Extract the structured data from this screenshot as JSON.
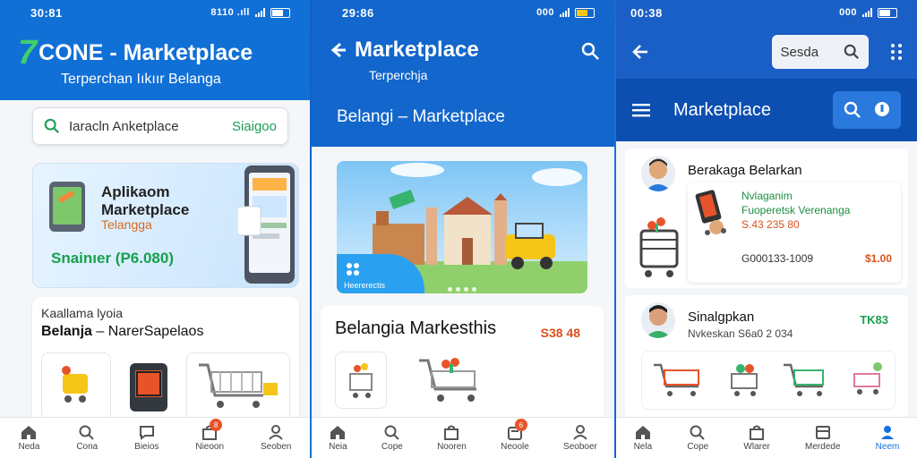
{
  "colors": {
    "brand_blue": "#1266cc",
    "accent_green": "#1f9d55",
    "accent_orange": "#d9521e",
    "active_nav": "#1570e0"
  },
  "screen1": {
    "status": {
      "time": "30:81",
      "icons": "8110 .ıll"
    },
    "logo_char": "7",
    "title": "CONE - Marketplace",
    "subtitle": "Terperchan Iıkıır Belanga",
    "search": {
      "placeholder": "Iaracln Anketplace",
      "button": "Siaigoo"
    },
    "banner": {
      "title_line1": "Aplikaom",
      "title_line2": "Marketplace",
      "tag": "Telangga",
      "price": "Snainıer (P6.080)"
    },
    "section": {
      "small": "Kaallama lyoia",
      "label_bold": "Belanja",
      "label_rest": " – NarerSapelaos"
    },
    "nav": [
      {
        "icon": "home-icon",
        "label": "Neda",
        "badge": ""
      },
      {
        "icon": "search-icon",
        "label": "Cona",
        "badge": ""
      },
      {
        "icon": "chat-icon",
        "label": "Bieios",
        "badge": ""
      },
      {
        "icon": "bag-icon",
        "label": "Nieoon",
        "badge": "8"
      },
      {
        "icon": "user-icon",
        "label": "Seoben",
        "badge": ""
      }
    ]
  },
  "screen2": {
    "status": {
      "time": "29:86",
      "icons": "000"
    },
    "title": "Marketplace",
    "subtitle": "Terperchja",
    "section_title": "Belangi – Marketplace",
    "hero": {
      "chip_label": "Heererectis"
    },
    "card": {
      "title": "Belangia Markesthis",
      "price": "S38 48"
    },
    "nav": [
      {
        "icon": "home-icon",
        "label": "Neia",
        "badge": ""
      },
      {
        "icon": "search-icon",
        "label": "Cope",
        "badge": ""
      },
      {
        "icon": "bag-icon",
        "label": "Nooren",
        "badge": ""
      },
      {
        "icon": "cart-icon",
        "label": "Neoole",
        "badge": "6"
      },
      {
        "icon": "user-icon",
        "label": "Seoboer",
        "badge": ""
      }
    ]
  },
  "screen3": {
    "status": {
      "time": "00:38",
      "icons": "000"
    },
    "search_label": "Sesda",
    "title": "Marketplace",
    "card_a": {
      "name": "Berakaga Belarkan",
      "line1": "Nvlaganim",
      "line2": "Fuoperetsk Verenanga",
      "line3": "S.43 235 80",
      "line4": "G000133-1009",
      "price": "$1.00"
    },
    "card_b": {
      "name": "Sinalgpkan",
      "sub": "Nvkeskan S6a0 2 034",
      "tag": "TK83"
    },
    "nav": [
      {
        "icon": "home-icon",
        "label": "Nela",
        "badge": ""
      },
      {
        "icon": "search-icon",
        "label": "Cope",
        "badge": ""
      },
      {
        "icon": "bag-icon",
        "label": "Wlarer",
        "badge": ""
      },
      {
        "icon": "book-icon",
        "label": "Merdede",
        "badge": ""
      },
      {
        "icon": "user-icon",
        "label": "Neem",
        "badge": ""
      }
    ]
  }
}
